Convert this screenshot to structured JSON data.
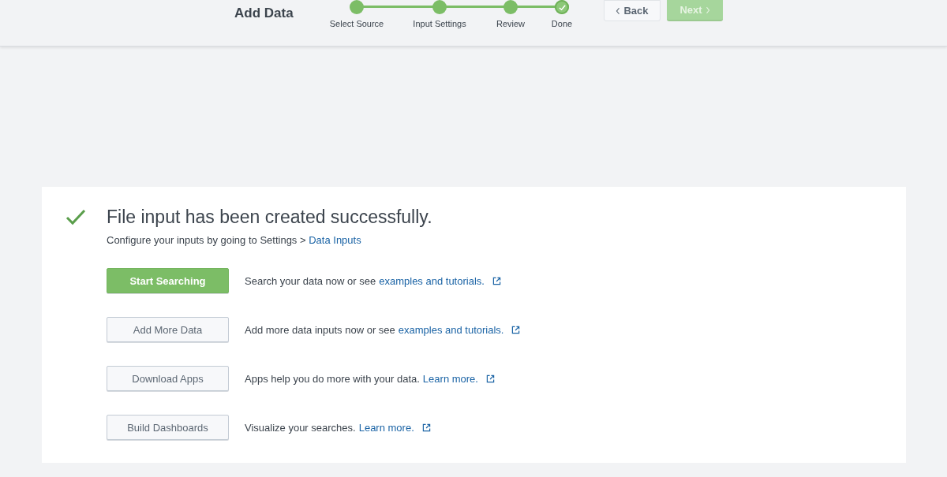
{
  "header": {
    "title": "Add Data",
    "steps": [
      {
        "label": "Select Source",
        "completed": true,
        "selected": false
      },
      {
        "label": "Input Settings",
        "completed": true,
        "selected": false
      },
      {
        "label": "Review",
        "completed": true,
        "selected": false
      },
      {
        "label": "Done",
        "completed": true,
        "selected": true
      }
    ],
    "back_button": {
      "label": "Back",
      "disabled": false
    },
    "next_button": {
      "label": "Next",
      "disabled": true
    }
  },
  "result": {
    "heading": "File input has been created successfully.",
    "subtext": "Configure your inputs by going to Settings >",
    "subtext_link": "Data Inputs",
    "actions": [
      {
        "button": "Start Searching",
        "kind": "primary",
        "text": "Search your data now or see",
        "link": "examples and tutorials."
      },
      {
        "button": "Add More Data",
        "kind": "secondary",
        "text": "Add more data inputs now or see",
        "link": "examples and tutorials."
      },
      {
        "button": "Download Apps",
        "kind": "secondary",
        "text": "Apps help you do more with your data.",
        "link": "Learn more."
      },
      {
        "button": "Build Dashboards",
        "kind": "secondary",
        "text": "Visualize your searches.",
        "link": "Learn more."
      }
    ]
  }
}
